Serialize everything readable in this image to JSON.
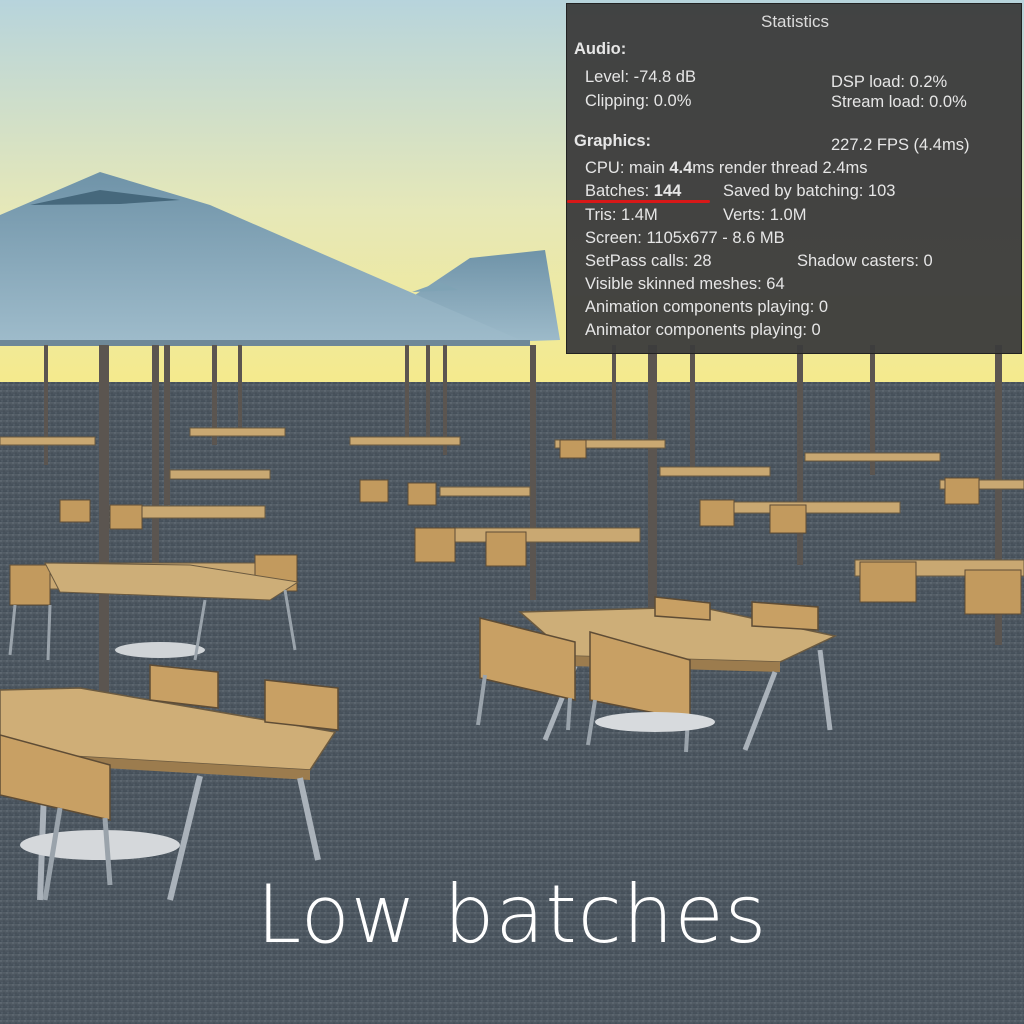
{
  "caption": "Low batches",
  "stats": {
    "title": "Statistics",
    "audio": {
      "heading": "Audio:",
      "level": "Level: -74.8 dB",
      "dsp_load": "DSP load: 0.2%",
      "clipping": "Clipping: 0.0%",
      "stream_load": "Stream load: 0.0%"
    },
    "graphics": {
      "heading": "Graphics:",
      "fps": "227.2 FPS (4.4ms)",
      "cpu_prefix": "CPU: main ",
      "cpu_main": "4.4",
      "cpu_suffix": "ms  render thread 2.4ms",
      "batches_prefix": "Batches: ",
      "batches": "144",
      "saved_by_batching": "Saved by batching: 103",
      "tris": "Tris: 1.4M",
      "verts": "Verts: 1.0M",
      "screen": "Screen: 1105x677 - 8.6 MB",
      "setpass": "SetPass calls: 28",
      "shadow_casters": "Shadow casters: 0",
      "skinned_meshes": "Visible skinned meshes: 64",
      "animation_components": "Animation components playing: 0",
      "animator_components": "Animator components playing: 0"
    }
  },
  "colors": {
    "sky_top": "#b9d6dc",
    "sky_horizon": "#f2ea9a",
    "ground": "#4b5660",
    "umbrella": "#7fa3b5",
    "table_top": "#c8a56c",
    "panel_bg": "#3c3c3c",
    "highlight_underline": "#d81818"
  }
}
